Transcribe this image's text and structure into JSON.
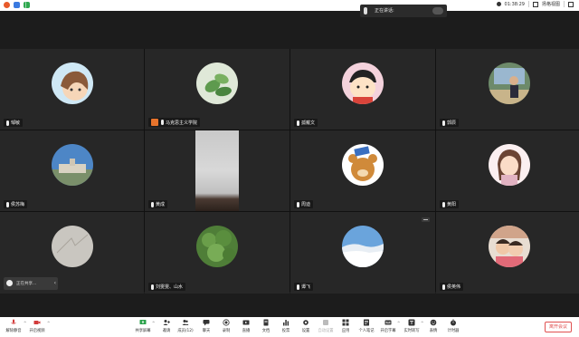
{
  "topbar": {
    "time": "01:38:29",
    "speaker_view_label": "扬格视图"
  },
  "speaking": {
    "label": "正在讲话:"
  },
  "participants": [
    {
      "name": "邹敏"
    },
    {
      "name": "马克思主义学院"
    },
    {
      "name": "孤戴文"
    },
    {
      "name": "郭辰"
    },
    {
      "name": "侯苏梅"
    },
    {
      "name": "黄成"
    },
    {
      "name": "周迪"
    },
    {
      "name": "黄阳"
    },
    {
      "name": ""
    },
    {
      "name": "刘雯雯、山水"
    },
    {
      "name": "谭飞"
    },
    {
      "name": "侯英伟"
    }
  ],
  "pill": {
    "text": "正在共享..."
  },
  "toolbar": {
    "items": [
      {
        "label": "解除静音"
      },
      {
        "label": "开启视频"
      },
      {
        "label": "共享屏幕"
      },
      {
        "label": "邀请"
      },
      {
        "label": "成员(12)"
      },
      {
        "label": "聊天"
      },
      {
        "label": "录制"
      },
      {
        "label": "直播"
      },
      {
        "label": "文档"
      },
      {
        "label": "投票"
      },
      {
        "label": "设置"
      },
      {
        "label": "自动设置"
      },
      {
        "label": "应用"
      },
      {
        "label": "个人笔记"
      },
      {
        "label": "开启字幕"
      },
      {
        "label": "实时转写"
      },
      {
        "label": "表情"
      },
      {
        "label": "计时器"
      }
    ],
    "end_label": "离开会议"
  },
  "colors": {
    "end_button": "#e05050",
    "host_badge": "#e8742c"
  }
}
